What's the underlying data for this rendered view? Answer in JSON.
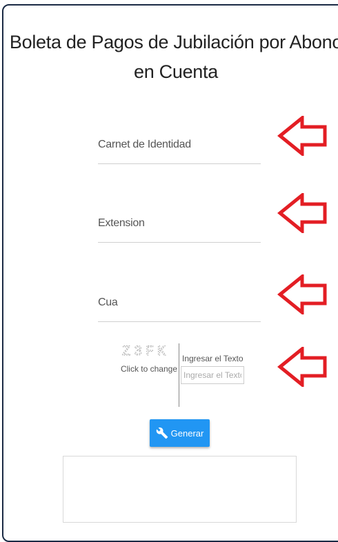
{
  "page": {
    "title": "Boleta de Pagos de Jubilación por Abono en Cuenta"
  },
  "form": {
    "carnet_label": "Carnet de Identidad",
    "extension_label": "Extension",
    "cua_label": "Cua"
  },
  "captcha": {
    "image_text": "Z3FK",
    "change_label": "Click to change",
    "input_label": "Ingresar el Texto",
    "input_placeholder": "Ingresar el Texto"
  },
  "button": {
    "generate_label": "Generar",
    "icon": "wrench-icon",
    "color": "#2196f3"
  },
  "annotations": {
    "arrow_color": "#e31e24"
  }
}
